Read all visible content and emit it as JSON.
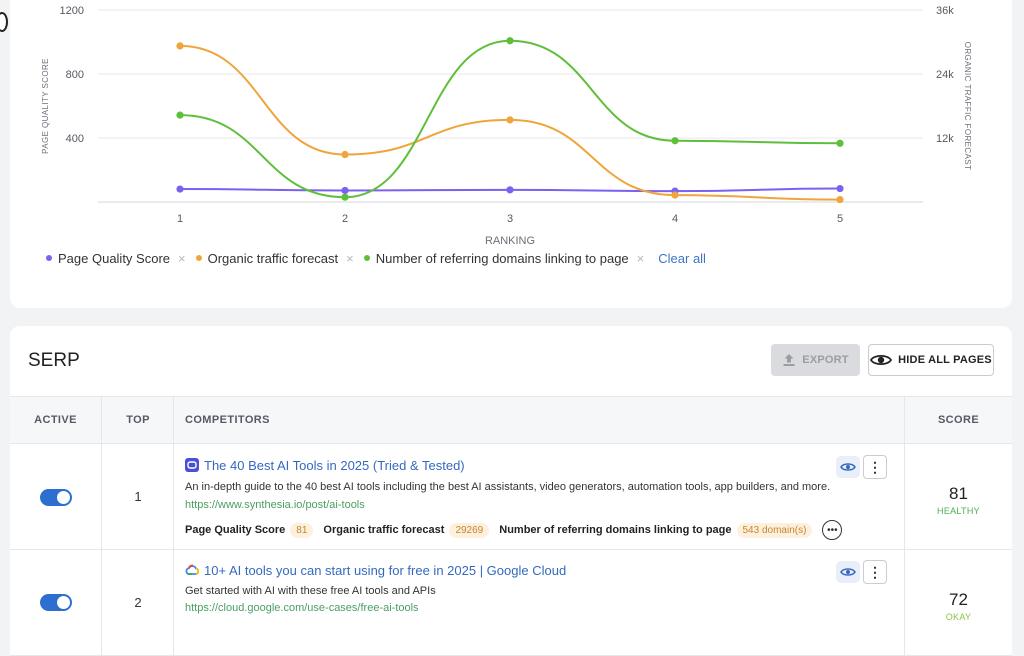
{
  "chart_data": {
    "type": "line",
    "xlabel": "RANKING",
    "ylabel_left": "PAGE QUALITY SCORE",
    "ylabel_right": "ORGANIC TRAFFIC FORECAST",
    "x": [
      1,
      2,
      3,
      4,
      5
    ],
    "x_tick_labels": [
      "1",
      "2",
      "3",
      "4",
      "5"
    ],
    "ylim_left": [
      0,
      1200
    ],
    "ylim_right": [
      0,
      36000
    ],
    "left_ticks": [
      "400",
      "800",
      "1200"
    ],
    "left_tick_values": [
      400,
      800,
      1200
    ],
    "right_ticks": [
      "12k",
      "24k",
      "36k"
    ],
    "right_tick_values": [
      12000,
      24000,
      36000
    ],
    "grid": true,
    "legend_position": "bottom-left",
    "series": [
      {
        "name": "Page Quality Score",
        "axis": "left",
        "color": "#7b61f2",
        "values": [
          81,
          72,
          76,
          68,
          84
        ]
      },
      {
        "name": "Organic traffic forecast",
        "axis": "right",
        "color": "#f0a53c",
        "values": [
          29269,
          8900,
          15400,
          1300,
          450
        ]
      },
      {
        "name": "Number of referring domains linking to page",
        "axis": "left",
        "color": "#5fbf3b",
        "values": [
          543,
          30,
          1008,
          383,
          367
        ]
      }
    ]
  },
  "legend": {
    "items": [
      {
        "label": "Page Quality Score",
        "color": "#7b61f2"
      },
      {
        "label": "Organic traffic forecast",
        "color": "#f0a53c"
      },
      {
        "label": "Number of referring domains linking to page",
        "color": "#5fbf3b"
      }
    ],
    "remove_icon": "×",
    "clear_all": "Clear all"
  },
  "serp": {
    "title": "SERP",
    "export_label": "EXPORT",
    "hide_label": "HIDE ALL PAGES",
    "columns": {
      "active": "ACTIVE",
      "top": "TOP",
      "competitors": "COMPETITORS",
      "score": "SCORE"
    },
    "rows": [
      {
        "active": true,
        "rank": "1",
        "icon": "synthesia-logo-icon",
        "title": "The 40 Best AI Tools in 2025 (Tried & Tested)",
        "description": "An in-depth guide to the 40 best AI tools including the best AI assistants, video generators, automation tools, app builders, and more.",
        "url": "https://www.synthesia.io/post/ai-tools",
        "metrics": [
          {
            "label": "Page Quality Score",
            "value": "81"
          },
          {
            "label": "Organic traffic forecast",
            "value": "29269"
          },
          {
            "label": "Number of referring domains linking to page",
            "value": "543 domain(s)"
          }
        ],
        "more_label": "•••",
        "score": "81",
        "score_label": "HEALTHY",
        "score_color": "#4caf50"
      },
      {
        "active": true,
        "rank": "2",
        "icon": "google-cloud-logo-icon",
        "title": "10+ AI tools you can start using for free in 2025 | Google Cloud",
        "description": "Get started with AI with these free AI tools and APIs",
        "url": "https://cloud.google.com/use-cases/free-ai-tools",
        "score": "72",
        "score_label": "OKAY",
        "score_color": "#8bc34a"
      }
    ]
  },
  "kebab_label": "⋮"
}
